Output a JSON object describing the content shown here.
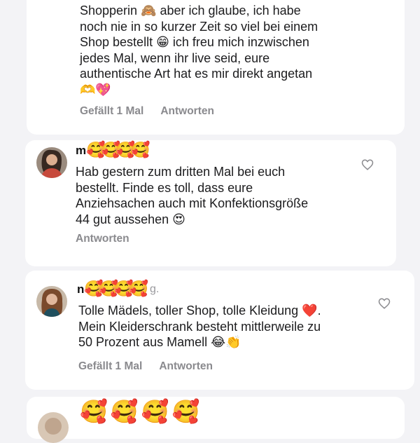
{
  "comments": [
    {
      "text": "Shopperin 🙈 aber ich glaube, ich habe\nnoch nie in so kurzer Zeit so viel bei einem\nShop bestellt 😁 ich freu mich inzwischen\njedes Mal, wenn ihr live seid, eure\nauthentische Art hat es mir direkt angetan\n🫶💖",
      "like_count_label": "Gefällt 1 Mal",
      "reply_label": "Antworten"
    },
    {
      "name_initial": "m",
      "name_emojis": "🥰🥰🥰🥰",
      "text": "Hab gestern zum dritten Mal bei euch\nbestellt. Finde es toll, dass eure\nAnziehsachen auch mit Konfektionsgröße\n44 gut aussehen 😍",
      "reply_label": "Antworten"
    },
    {
      "name_initial": "n",
      "name_emojis": "🥰🥰🥰🥰",
      "name_tail": "g.",
      "text": "Tolle Mädels, toller Shop, tolle Kleidung ❤️.\nMein Kleiderschrank besteht mittlerweile zu\n50 Prozent aus Mamell 😂👏",
      "like_count_label": "Gefällt 1 Mal",
      "reply_label": "Antworten"
    },
    {
      "name_emojis": "🥰🥰🥰🥰"
    }
  ],
  "icons": {
    "like": "heart-outline-icon",
    "avatar": "profile-photo"
  },
  "colors": {
    "background": "#f3f3f6",
    "card": "#ffffff",
    "text": "#1c1c1e",
    "muted": "#8a8a8e"
  }
}
